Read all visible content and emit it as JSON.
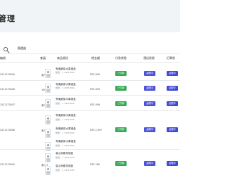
{
  "header": {
    "title": "管理"
  },
  "toolbar": {
    "filter_label": "篩選器"
  },
  "table": {
    "headers": {
      "order_id": "編號",
      "customer": "會員",
      "product_info": "商品資訊",
      "total": "總金額",
      "payment_status": "付款狀態",
      "shipping_status": "運送狀態",
      "order_status": "訂單狀"
    },
    "rows": [
      {
        "order_id": "2411270009",
        "customer": "客人甲",
        "product_name": "有機蔬菜水果禮盒",
        "product_meta": "數量：1 / NT$ 899",
        "total": "NT$ 899",
        "payment_status": "已付款",
        "shipping_status": "處理中",
        "order_status": "處理中"
      },
      {
        "order_id": "2411270008",
        "customer": "3960號",
        "product_name": "有機蔬菜水果禮盒",
        "product_meta": "數量：1 / NT$ 899",
        "total": "NT$ 899",
        "payment_status": "已付款",
        "shipping_status": "處理中",
        "order_status": "處理中"
      },
      {
        "order_id": "2411270007",
        "customer": "客人乙",
        "product_name": "有機蔬菜水果禮盒",
        "product_meta": "數量：1 / NT$ 899",
        "total": "NT$ 899",
        "payment_status": "已付款",
        "shipping_status": "處理中",
        "order_status": "處理中"
      },
      {
        "order_id": "2411270006",
        "customer": "客人丙",
        "product_name": "有機蔬菜水果禮盒",
        "product_meta": "數量：1 / NT$ 899",
        "total": "NT$ 2,697",
        "payment_status": "已付款",
        "shipping_status": "處理中",
        "order_status": "處理中"
      },
      {
        "order_id": "2411270005",
        "customer": "客人丁",
        "product_name": "高山烏龍茶禮盒",
        "product_meta": "數量：1 / NT$ 580",
        "total": "NT$ 580",
        "payment_status": "已付款",
        "shipping_status": "處理中",
        "order_status": "處理中"
      }
    ]
  },
  "colors": {
    "header_background": "#f1f4f6",
    "payment_badge": "#35a853",
    "shipping_badge": "#4c52d6",
    "order_status_badge": "#3e4ad7",
    "divider": "#e7eaed"
  },
  "icons": {
    "search": "search-icon",
    "product": "product-thumbnail-icon"
  }
}
